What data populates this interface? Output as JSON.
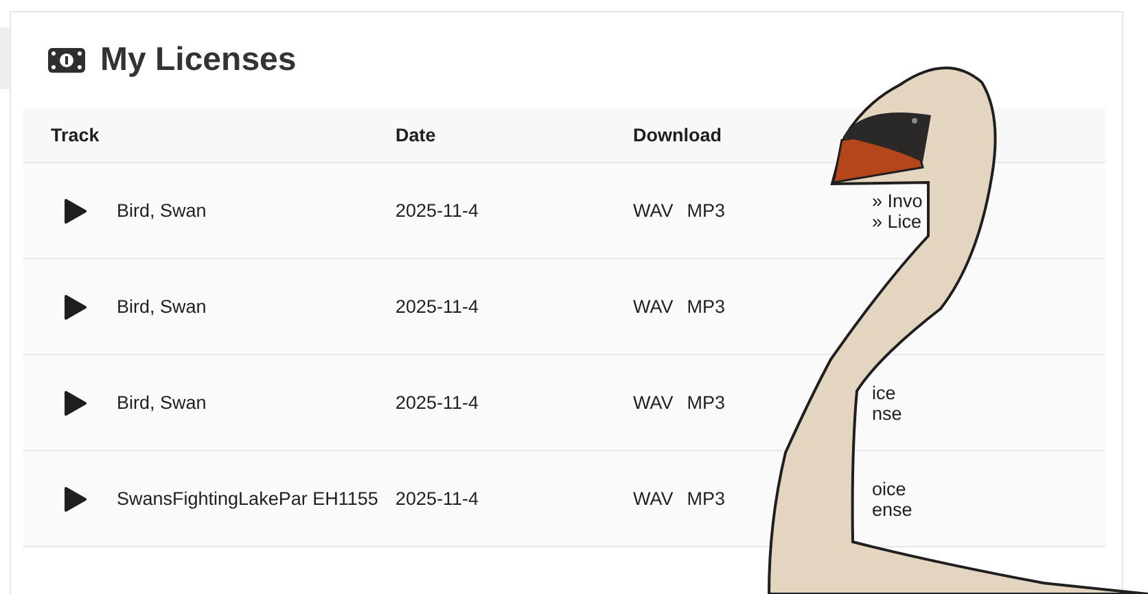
{
  "page": {
    "title": "My Licenses"
  },
  "table": {
    "columns": [
      "Track",
      "Date",
      "Download"
    ],
    "rows": [
      {
        "track": "Bird, Swan",
        "date": "2025-11-4",
        "downloads": [
          "WAV",
          "MP3"
        ],
        "links": [
          "» Invo",
          "» Lice"
        ]
      },
      {
        "track": "Bird, Swan",
        "date": "2025-11-4",
        "downloads": [
          "WAV",
          "MP3"
        ]
      },
      {
        "track": "Bird, Swan",
        "date": "2025-11-4",
        "downloads": [
          "WAV",
          "MP3"
        ],
        "links": [
          "ice",
          "nse"
        ]
      },
      {
        "track": "SwansFightingLakePar EH1155",
        "date": "2025-11-4",
        "downloads": [
          "WAV",
          "MP3"
        ],
        "links": [
          "oice",
          "ense"
        ]
      }
    ]
  }
}
